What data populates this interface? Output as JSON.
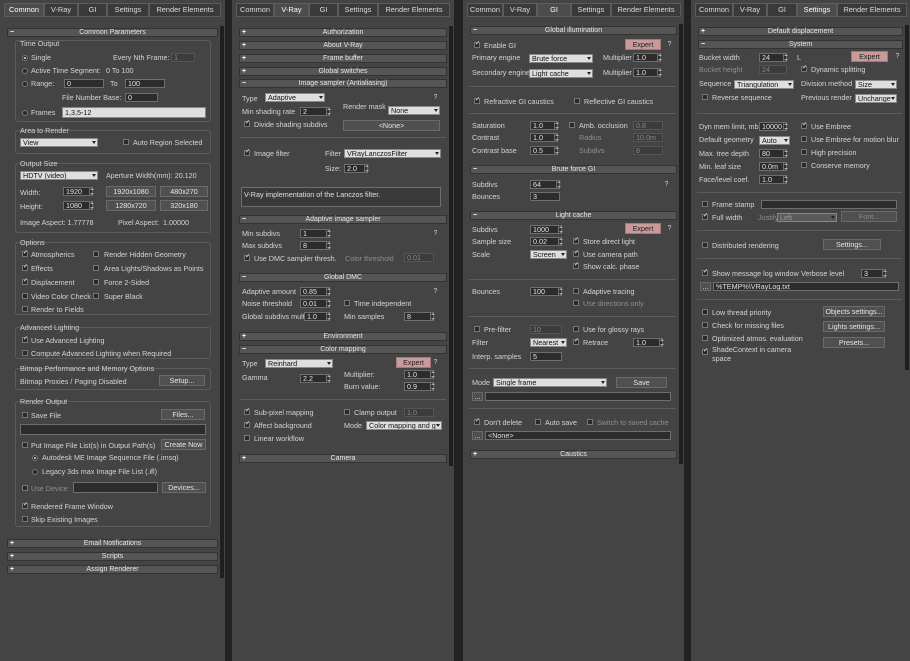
{
  "panel1": {
    "tabs": [
      "Common",
      "V-Ray",
      "GI",
      "Settings",
      "Render Elements"
    ],
    "common_params": "Common Parameters",
    "time_output": "Time Output",
    "single": "Single",
    "every_nth": "Every Nth Frame:",
    "every_nth_val": "1",
    "active_seg": "Active Time Segment:",
    "active_seg_val": "0 To 100",
    "range": "Range:",
    "range_from": "0",
    "range_to_lbl": "To",
    "range_to": "100",
    "file_num_base": "File Number Base:",
    "file_num_base_val": "0",
    "frames": "Frames",
    "frames_val": "1,3,5-12",
    "area_to_render": "Area to Render",
    "area_dd": "View",
    "auto_region": "Auto Region Selected",
    "output_size": "Output Size",
    "output_dd": "HDTV (video)",
    "aperture": "Aperture Width(mm): 20.120",
    "width_lbl": "Width:",
    "width_val": "1920",
    "height_lbl": "Height:",
    "height_val": "1080",
    "res1": "1920x1080",
    "res2": "480x270",
    "res3": "1280x720",
    "res4": "320x180",
    "img_aspect": "Image Aspect: 1.77778",
    "pix_aspect": "Pixel Aspect:",
    "pix_aspect_val": "1.00000",
    "options": "Options",
    "atmospherics": "Atmospherics",
    "render_hidden": "Render Hidden Geometry",
    "effects": "Effects",
    "area_lights": "Area Lights/Shadows as Points",
    "displacement": "Displacement",
    "force_2sided": "Force 2-Sided",
    "video_color": "Video Color Check",
    "super_black": "Super Black",
    "render_fields": "Render to Fields",
    "adv_lighting": "Advanced Lighting",
    "use_adv": "Use Advanced Lighting",
    "compute_adv": "Compute Advanced Lighting when Required",
    "bitmap_perf": "Bitmap Performance and Memory Options",
    "bitmap_proxies": "Bitmap Proxies / Paging Disabled",
    "setup": "Setup...",
    "render_output": "Render Output",
    "save_file": "Save File",
    "files": "Files...",
    "put_image": "Put Image File List(s) in Output Path(s)",
    "create_now": "Create Now",
    "autodesk_me": "Autodesk ME Image Sequence File (.imsq)",
    "legacy": "Legacy 3ds max Image File List (.ifl)",
    "use_device": "Use Device",
    "devices": "Devices...",
    "rendered_frame": "Rendered Frame Window",
    "skip_existing": "Skip Existing Images",
    "email": "Email Notifications",
    "scripts": "Scripts",
    "assign_renderer": "Assign Renderer"
  },
  "panel2": {
    "tabs": [
      "Common",
      "V-Ray",
      "GI",
      "Settings",
      "Render Elements"
    ],
    "authorization": "Authorization",
    "about": "About V-Ray",
    "frame_buffer": "Frame buffer",
    "global_switches": "Global switches",
    "image_sampler": "Image sampler (Antialiasing)",
    "type_lbl": "Type",
    "type_val": "Adaptive",
    "min_shading": "Min shading rate",
    "min_shading_val": "2",
    "render_mask": "Render mask",
    "render_mask_val": "None",
    "none_btn": "<None>",
    "divide_shading": "Divide shading subdivs",
    "image_filter": "Image filter",
    "filter_lbl": "Filter",
    "filter_val": "VRayLanczosFilter",
    "size_lbl": "Size:",
    "size_val": "2.0",
    "filter_desc": "V-Ray implementation of the Lanczos filter.",
    "adaptive_sampler": "Adaptive image sampler",
    "min_subdivs": "Min subdivs",
    "min_subdivs_val": "1",
    "max_subdivs": "Max subdivs",
    "max_subdivs_val": "8",
    "use_dmc": "Use DMC sampler thresh.",
    "color_thresh": "Color threshold",
    "color_thresh_val": "0.01",
    "global_dmc": "Global DMC",
    "adaptive_amount": "Adaptive amount",
    "adaptive_amount_val": "0.85",
    "noise_thresh": "Noise threshold",
    "noise_thresh_val": "0.01",
    "time_indep": "Time independent",
    "global_subdivs": "Global subdivs mult.",
    "global_subdivs_val": "1.0",
    "min_samples": "Min samples",
    "min_samples_val": "8",
    "environment": "Environment",
    "color_mapping": "Color mapping",
    "cm_type": "Type",
    "cm_type_val": "Reinhard",
    "expert": "Expert",
    "gamma": "Gamma",
    "gamma_val": "2.2",
    "multiplier": "Multiplier:",
    "multiplier_val": "1.0",
    "burn": "Burn value:",
    "burn_val": "0.9",
    "subpixel": "Sub-pixel mapping",
    "clamp": "Clamp output",
    "clamp_val": "1.0",
    "affect_bg": "Affect background",
    "mode": "Mode",
    "mode_val": "Color mapping and g",
    "linear_wf": "Linear workflow",
    "camera": "Camera"
  },
  "panel3": {
    "tabs": [
      "Common",
      "V-Ray",
      "GI",
      "Settings",
      "Render Elements"
    ],
    "global_illum": "Global illumination",
    "enable_gi": "Enable GI",
    "expert": "Expert",
    "primary": "Primary engine",
    "primary_val": "Brute force",
    "mult_lbl": "Multiplier",
    "mult1": "1.0",
    "secondary": "Secondary engine",
    "secondary_val": "Light cache",
    "mult2": "1.0",
    "refractive": "Refractive GI caustics",
    "reflective": "Reflective GI caustics",
    "saturation": "Saturation",
    "saturation_val": "1.0",
    "amb_occ": "Amb. occlusion",
    "amb_occ_val": "0.8",
    "contrast": "Contrast",
    "contrast_val": "1.0",
    "radius": "Radius",
    "radius_val": "10.0m",
    "contrast_base": "Contrast base",
    "contrast_base_val": "0.5",
    "subdivs_ao": "Subdivs",
    "subdivs_ao_val": "8",
    "brute": "Brute force GI",
    "bf_subdivs": "Subdivs",
    "bf_subdivs_val": "64",
    "bounces": "Bounces",
    "bounces_val": "3",
    "light_cache": "Light cache",
    "lc_subdivs": "Subdivs",
    "lc_subdivs_val": "1000",
    "sample_size": "Sample size",
    "sample_size_val": "0.02",
    "store_direct": "Store direct light",
    "scale": "Scale",
    "scale_val": "Screen",
    "use_cam": "Use camera path",
    "show_calc": "Show calc. phase",
    "lc_bounces": "Bounces",
    "lc_bounces_val": "100",
    "adaptive_tracing": "Adaptive tracing",
    "use_dirs": "Use directions only",
    "prefilter": "Pre-filter",
    "prefilter_val": "10",
    "use_glossy": "Use for glossy rays",
    "filter": "Filter",
    "filter_val": "Nearest",
    "retrace": "Retrace",
    "retrace_val": "1.0",
    "interp": "Interp. samples",
    "interp_val": "5",
    "mode": "Mode",
    "mode_val": "Single frame",
    "save": "Save",
    "dots": "...",
    "dont_delete": "Don't delete",
    "auto_save": "Auto save",
    "switch_saved": "Switch to saved cache",
    "none": "<None>",
    "caustics": "Caustics"
  },
  "panel4": {
    "tabs": [
      "Common",
      "V-Ray",
      "GI",
      "Settings",
      "Render Elements"
    ],
    "default_disp": "Default displacement",
    "system": "System",
    "bucket_w": "Bucket width",
    "bucket_w_val": "24",
    "l_lbl": "L",
    "expert": "Expert",
    "bucket_h": "Bucket height",
    "bucket_h_val": "24",
    "dyn_split": "Dynamic splitting",
    "sequence": "Sequence",
    "sequence_val": "Triangulation",
    "division": "Division method",
    "division_val": "Size",
    "reverse": "Reverse sequence",
    "prev_render": "Previous render",
    "prev_render_val": "Unchange",
    "dyn_mem": "Dyn mem limit, mb",
    "dyn_mem_val": "10000",
    "use_embree": "Use Embree",
    "def_geom": "Default geometry",
    "def_geom_val": "Auto",
    "embree_blur": "Use Embree for motion blur",
    "max_tree": "Max. tree depth",
    "max_tree_val": "80",
    "high_prec": "High precision",
    "min_leaf": "Min. leaf size",
    "min_leaf_val": "0.0m",
    "conserve": "Conserve memory",
    "face_level": "Face/level coef.",
    "face_level_val": "1.0",
    "frame_stamp": "Frame stamp",
    "full_width": "Full width",
    "justify": "Justify",
    "justify_val": "Left",
    "font": "Font...",
    "distributed": "Distributed rendering",
    "settings": "Settings...",
    "show_log": "Show message log window",
    "verbose": "Verbose level",
    "verbose_val": "3",
    "dots": "...",
    "log_path": "%TEMP%\\VRayLog.txt",
    "low_thread": "Low thread priority",
    "objects_settings": "Objects settings...",
    "check_missing": "Check for missing files",
    "lights_settings": "Lights settings...",
    "optimized": "Optimized atmos. evaluation",
    "presets": "Presets...",
    "shade_ctx": "ShadeContext in camera space"
  }
}
